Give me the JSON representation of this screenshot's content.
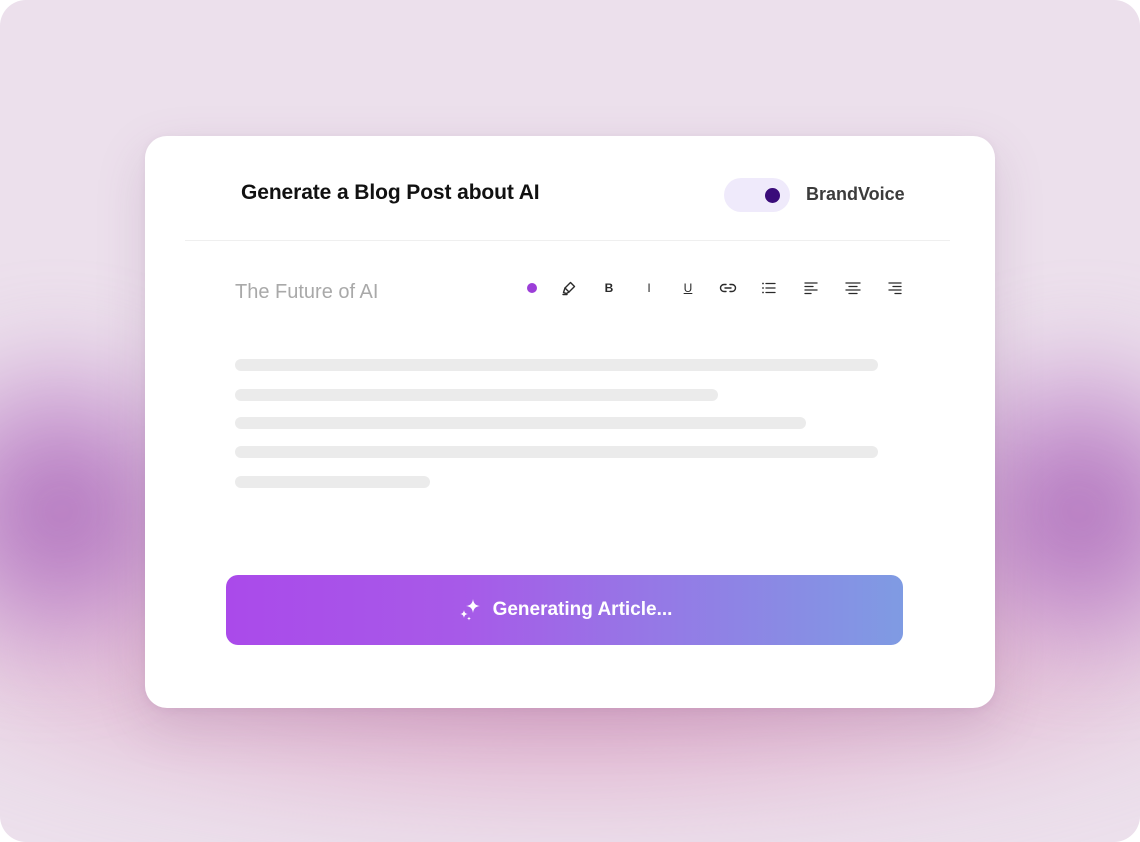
{
  "colors": {
    "background": "#ece0ec",
    "card": "#ffffff",
    "toggle_track": "#efeafb",
    "toggle_knob": "#3a0c7a",
    "accent_dot": "#9c3ed8",
    "button_gradient_start": "#aa4aea",
    "button_gradient_end": "#7f9be3"
  },
  "header": {
    "title": "Generate a Blog Post about AI",
    "toggle": {
      "label": "BrandVoice",
      "on": true
    }
  },
  "editor": {
    "document_title": "The Future of AI",
    "toolbar": [
      {
        "name": "text-color",
        "icon": "color-dot-icon"
      },
      {
        "name": "highlight",
        "icon": "highlighter-icon"
      },
      {
        "name": "bold",
        "label": "B",
        "icon": "bold-icon"
      },
      {
        "name": "italic",
        "label": "I",
        "icon": "italic-icon"
      },
      {
        "name": "underline",
        "label": "U",
        "icon": "underline-icon"
      },
      {
        "name": "link",
        "icon": "link-icon"
      },
      {
        "name": "list",
        "icon": "bulleted-list-icon"
      },
      {
        "name": "align-left",
        "icon": "align-left-icon"
      },
      {
        "name": "align-center",
        "icon": "align-center-icon"
      },
      {
        "name": "align-right",
        "icon": "align-right-icon"
      }
    ],
    "loading_lines": 5
  },
  "action": {
    "label": "Generating Article...",
    "icon": "sparkles-icon"
  }
}
